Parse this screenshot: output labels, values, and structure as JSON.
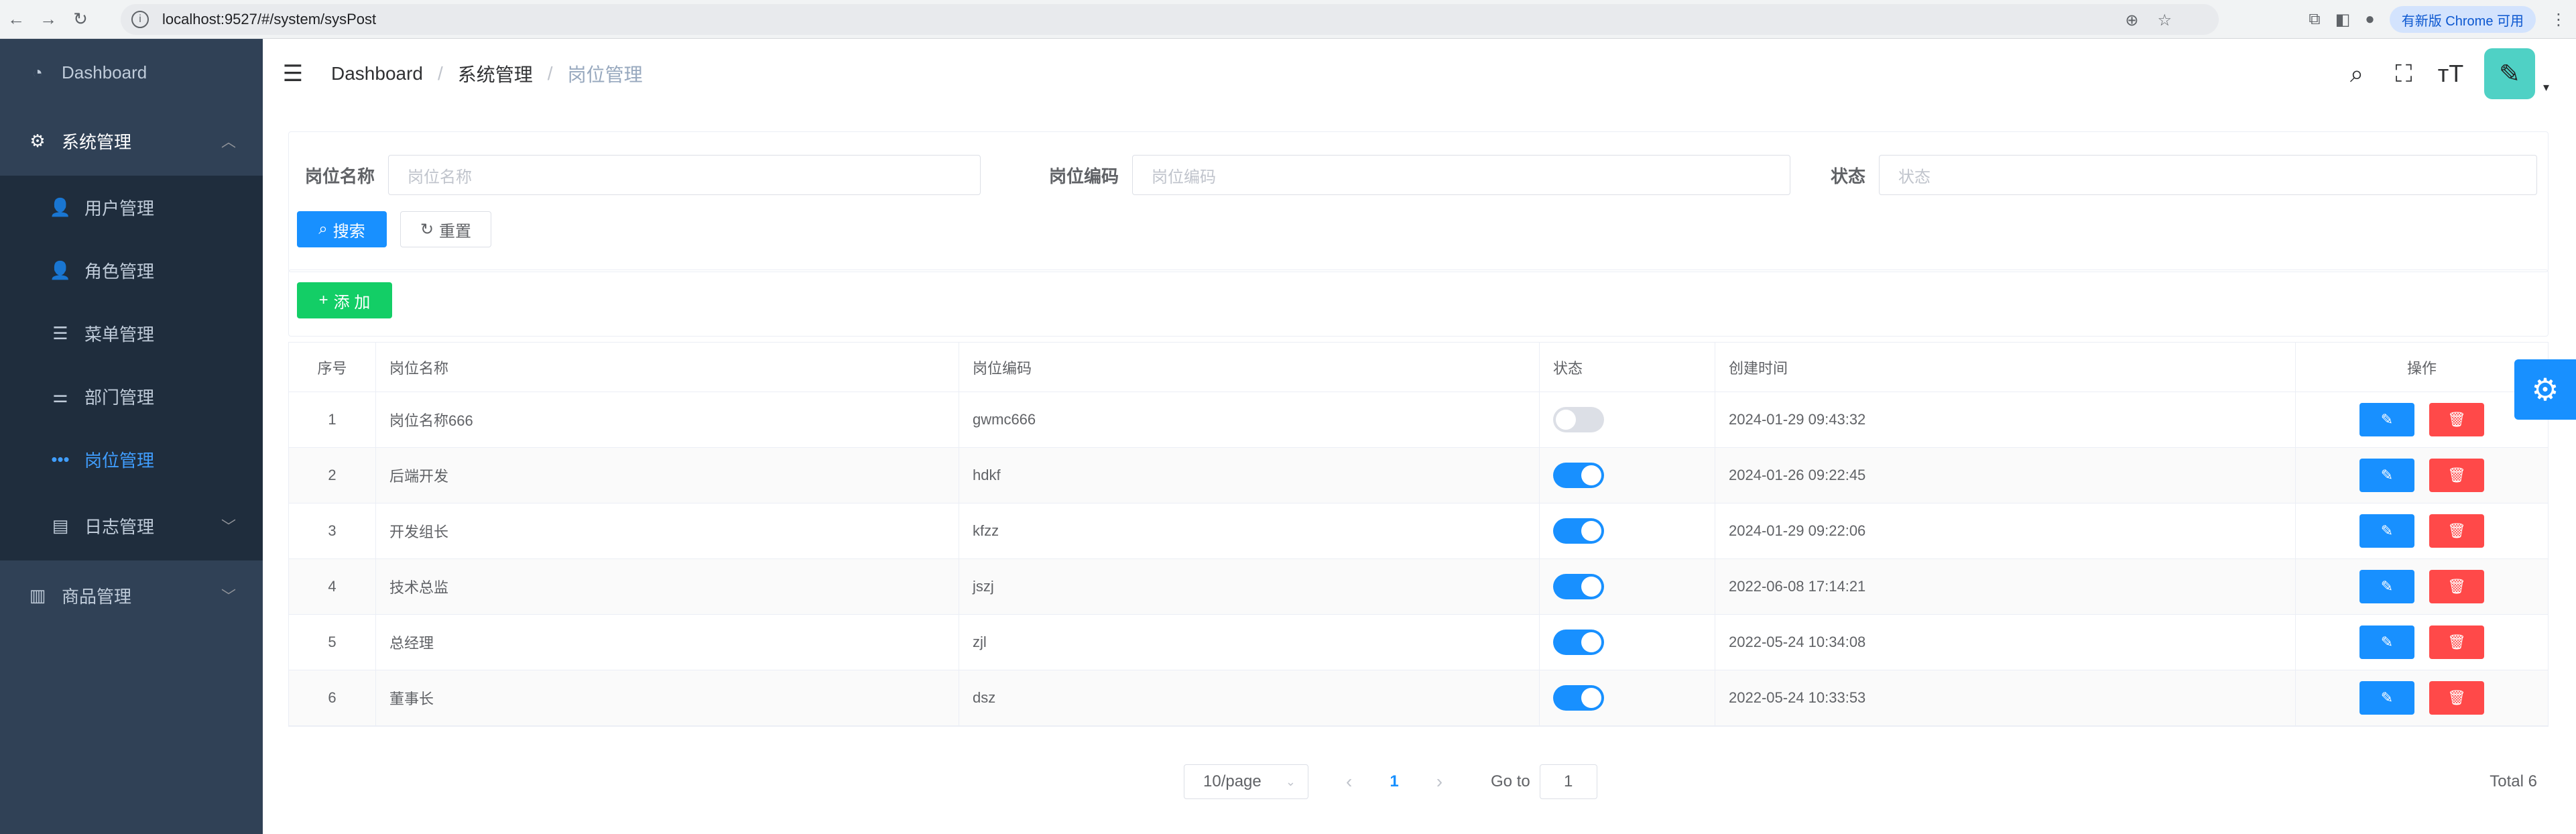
{
  "browser": {
    "url": "localhost:9527/#/system/sysPost",
    "update_label": "有新版 Chrome 可用"
  },
  "sidebar": {
    "dashboard": "Dashboard",
    "system": "系统管理",
    "subs": [
      "用户管理",
      "角色管理",
      "菜单管理",
      "部门管理",
      "岗位管理",
      "日志管理"
    ],
    "goods": "商品管理"
  },
  "breadcrumb": {
    "home": "Dashboard",
    "level1": "系统管理",
    "current": "岗位管理",
    "sep": "/"
  },
  "search": {
    "name_label": "岗位名称",
    "name_placeholder": "岗位名称",
    "code_label": "岗位编码",
    "code_placeholder": "岗位编码",
    "status_label": "状态",
    "status_placeholder": "状态",
    "search_btn": "搜索",
    "reset_btn": "重置"
  },
  "toolbar": {
    "add_btn": "添 加"
  },
  "table": {
    "headers": [
      "序号",
      "岗位名称",
      "岗位编码",
      "状态",
      "创建时间",
      "操作"
    ],
    "rows": [
      {
        "no": "1",
        "name": "岗位名称666",
        "code": "gwmc666",
        "status": false,
        "time": "2024-01-29 09:43:32"
      },
      {
        "no": "2",
        "name": "后端开发",
        "code": "hdkf",
        "status": true,
        "time": "2024-01-26 09:22:45"
      },
      {
        "no": "3",
        "name": "开发组长",
        "code": "kfzz",
        "status": true,
        "time": "2024-01-29 09:22:06"
      },
      {
        "no": "4",
        "name": "技术总监",
        "code": "jszj",
        "status": true,
        "time": "2022-06-08 17:14:21"
      },
      {
        "no": "5",
        "name": "总经理",
        "code": "zjl",
        "status": true,
        "time": "2022-05-24 10:34:08"
      },
      {
        "no": "6",
        "name": "董事长",
        "code": "dsz",
        "status": true,
        "time": "2022-05-24 10:33:53"
      }
    ]
  },
  "pagination": {
    "page_size": "10/page",
    "current_page": "1",
    "goto_label": "Go to",
    "goto_value": "1",
    "total": "Total 6"
  },
  "colors": {
    "sidebar_bg": "#304156",
    "submenu_bg": "#1f2d3d",
    "primary": "#1890ff",
    "success": "#13ce66",
    "danger": "#ff4949",
    "avatar": "#4fd1c5"
  }
}
